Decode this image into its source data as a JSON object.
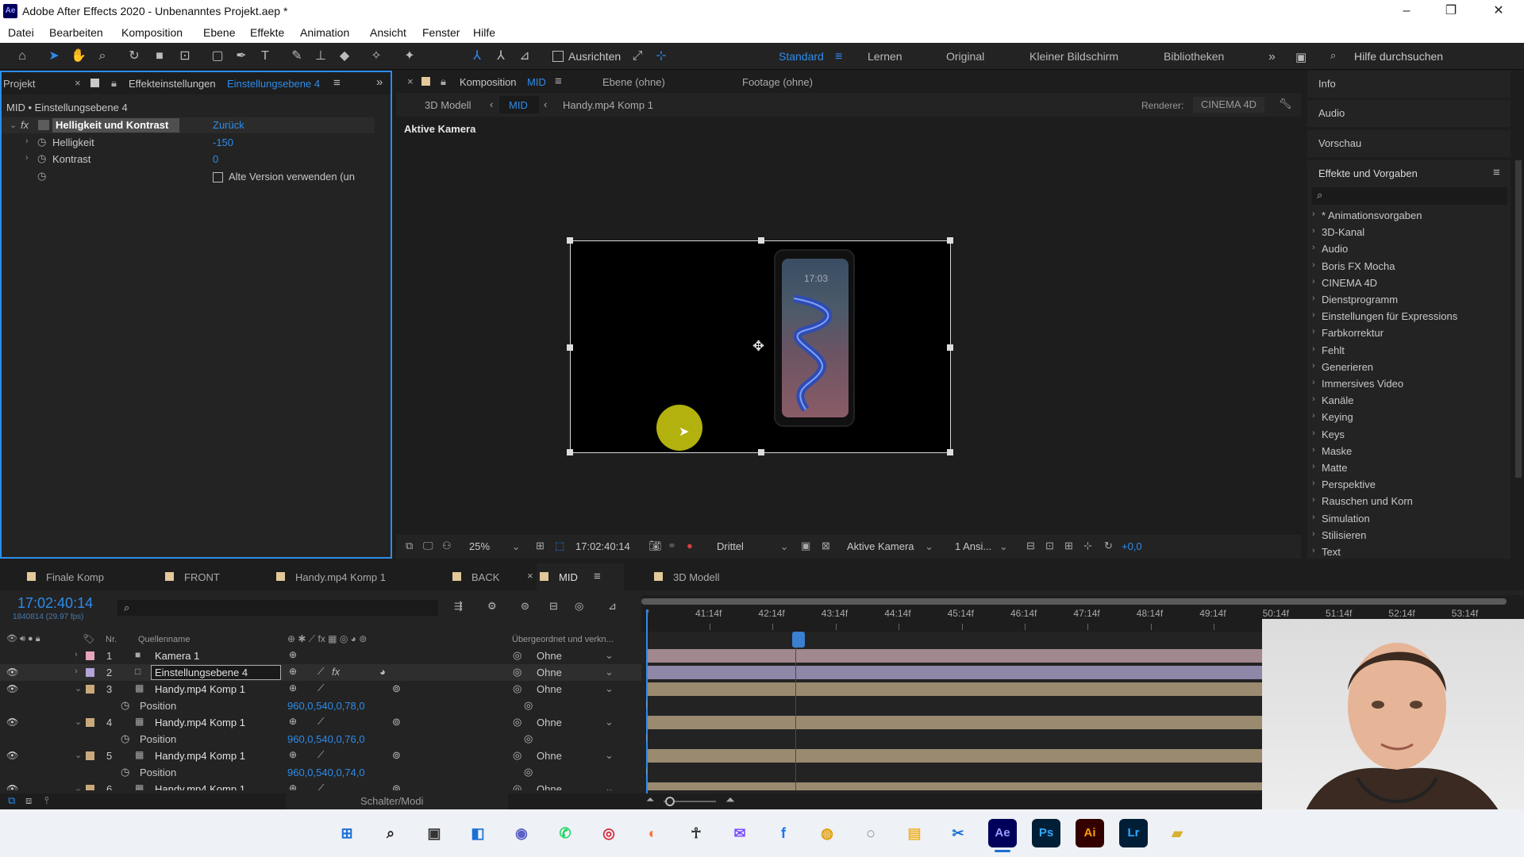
{
  "window": {
    "title": "Adobe After Effects 2020 - Unbenanntes Projekt.aep *",
    "app_icon": "Ae"
  },
  "menu": [
    "Datei",
    "Bearbeiten",
    "Komposition",
    "Ebene",
    "Effekte",
    "Animation",
    "Ansicht",
    "Fenster",
    "Hilfe"
  ],
  "toolbar": {
    "align_label": "Ausrichten",
    "workspaces": [
      "Standard",
      "Lernen",
      "Original",
      "Kleiner Bildschirm",
      "Bibliotheken"
    ],
    "search_placeholder": "Hilfe durchsuchen"
  },
  "effect_panel": {
    "project_tab": "Projekt",
    "tab_label": "Effekteinstellungen",
    "tab_layer": "Einstellungsebene 4",
    "breadcrumb": "MID • Einstellungsebene 4",
    "effect_name": "Helligkeit und Kontrast",
    "reset_label": "Zurück",
    "props": [
      {
        "name": "Helligkeit",
        "value": "-150"
      },
      {
        "name": "Kontrast",
        "value": "0"
      }
    ],
    "legacy_checkbox": "Alte Version verwenden (un"
  },
  "composition_panel": {
    "tab_label": "Komposition",
    "tab_comp": "MID",
    "tab_layer": "Ebene (ohne)",
    "tab_footage": "Footage (ohne)",
    "breadcrumbs": [
      "3D Modell",
      "MID",
      "Handy.mp4 Komp 1"
    ],
    "renderer_label": "Renderer:",
    "renderer_value": "CINEMA 4D",
    "camera_label": "Aktive Kamera",
    "phone_time": "17:03",
    "bottom": {
      "zoom": "25%",
      "timecode": "17:02:40:14",
      "grid": "Drittel",
      "camera": "Aktive Kamera",
      "views": "1 Ansi...",
      "exposure": "+0,0"
    }
  },
  "right_panels": {
    "tabs": [
      "Info",
      "Audio",
      "Vorschau"
    ],
    "effects_title": "Effekte und Vorgaben",
    "categories": [
      "* Animationsvorgaben",
      "3D-Kanal",
      "Audio",
      "Boris FX Mocha",
      "CINEMA 4D",
      "Dienstprogramm",
      "Einstellungen für Expressions",
      "Farbkorrektur",
      "Fehlt",
      "Generieren",
      "Immersives Video",
      "Kanäle",
      "Keying",
      "Keys",
      "Maske",
      "Matte",
      "Perspektive",
      "Rauschen und Korn",
      "Simulation",
      "Stilisieren",
      "Text"
    ]
  },
  "timeline": {
    "comp_tabs": [
      {
        "label": "Finale Komp",
        "color": "#e3c89a"
      },
      {
        "label": "FRONT",
        "color": "#e3c89a"
      },
      {
        "label": "Handy.mp4 Komp 1",
        "color": "#e3c89a"
      },
      {
        "label": "BACK",
        "color": "#e3c89a"
      },
      {
        "label": "MID",
        "color": "#e3c89a"
      },
      {
        "label": "3D Modell",
        "color": "#e3c89a"
      }
    ],
    "timecode": "17:02:40:14",
    "frame_info": "1840814 (29.97 fps)",
    "col_nr": "Nr.",
    "col_source": "Quellenname",
    "col_parent": "Übergeordnet und verkn...",
    "ruler": [
      "41:14f",
      "42:14f",
      "43:14f",
      "44:14f",
      "45:14f",
      "46:14f",
      "47:14f",
      "48:14f",
      "49:14f",
      "50:14f",
      "51:14f",
      "52:14f",
      "53:14f"
    ],
    "layers": [
      {
        "nr": "1",
        "name": "Kamera 1",
        "parent": "Ohne",
        "color": "#e6a6b9"
      },
      {
        "nr": "2",
        "name": "Einstellungsebene 4",
        "parent": "Ohne",
        "color": "#b4a4d8"
      },
      {
        "nr": "3",
        "name": "Handy.mp4 Komp 1",
        "parent": "Ohne",
        "color": "#c9a97c",
        "position": "960,0,540,0,78,0"
      },
      {
        "nr": "4",
        "name": "Handy.mp4 Komp 1",
        "parent": "Ohne",
        "color": "#c9a97c",
        "position": "960,0,540,0,76,0"
      },
      {
        "nr": "5",
        "name": "Handy.mp4 Komp 1",
        "parent": "Ohne",
        "color": "#c9a97c",
        "position": "960,0,540,0,74,0"
      },
      {
        "nr": "6",
        "name": "Handy.mp4 Komp 1",
        "parent": "Ohne",
        "color": "#c9a97c"
      }
    ],
    "position_label": "Position",
    "footer_label": "Schalter/Modi"
  },
  "taskbar": [
    "windows-start",
    "search",
    "task-view",
    "widgets",
    "teams",
    "whatsapp",
    "screen-recorder",
    "firefox",
    "tools",
    "messenger",
    "facebook",
    "browser",
    "obs",
    "explorer",
    "capcut",
    "after-effects",
    "photoshop",
    "illustrator",
    "lightroom",
    "folder"
  ]
}
